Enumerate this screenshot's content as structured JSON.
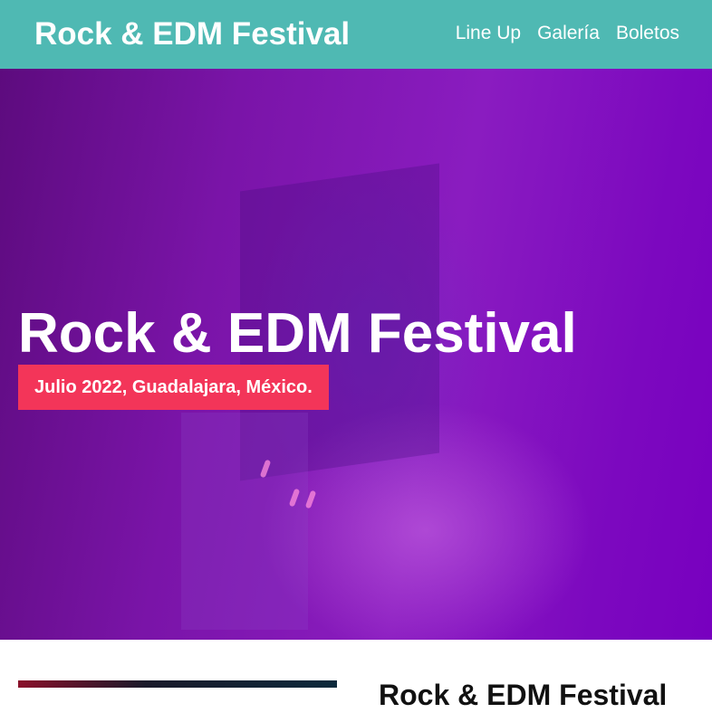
{
  "header": {
    "brand": "Rock & EDM Festival",
    "nav": [
      {
        "label": "Line Up"
      },
      {
        "label": "Galería"
      },
      {
        "label": "Boletos"
      }
    ]
  },
  "hero": {
    "title": "Rock & EDM Festival",
    "badge": "Julio 2022, Guadalajara, México."
  },
  "content": {
    "heading": "Rock & EDM Festival"
  },
  "colors": {
    "header_bg": "#4fb9b3",
    "hero_purple": "#7800bf",
    "badge_bg": "#f33559"
  }
}
